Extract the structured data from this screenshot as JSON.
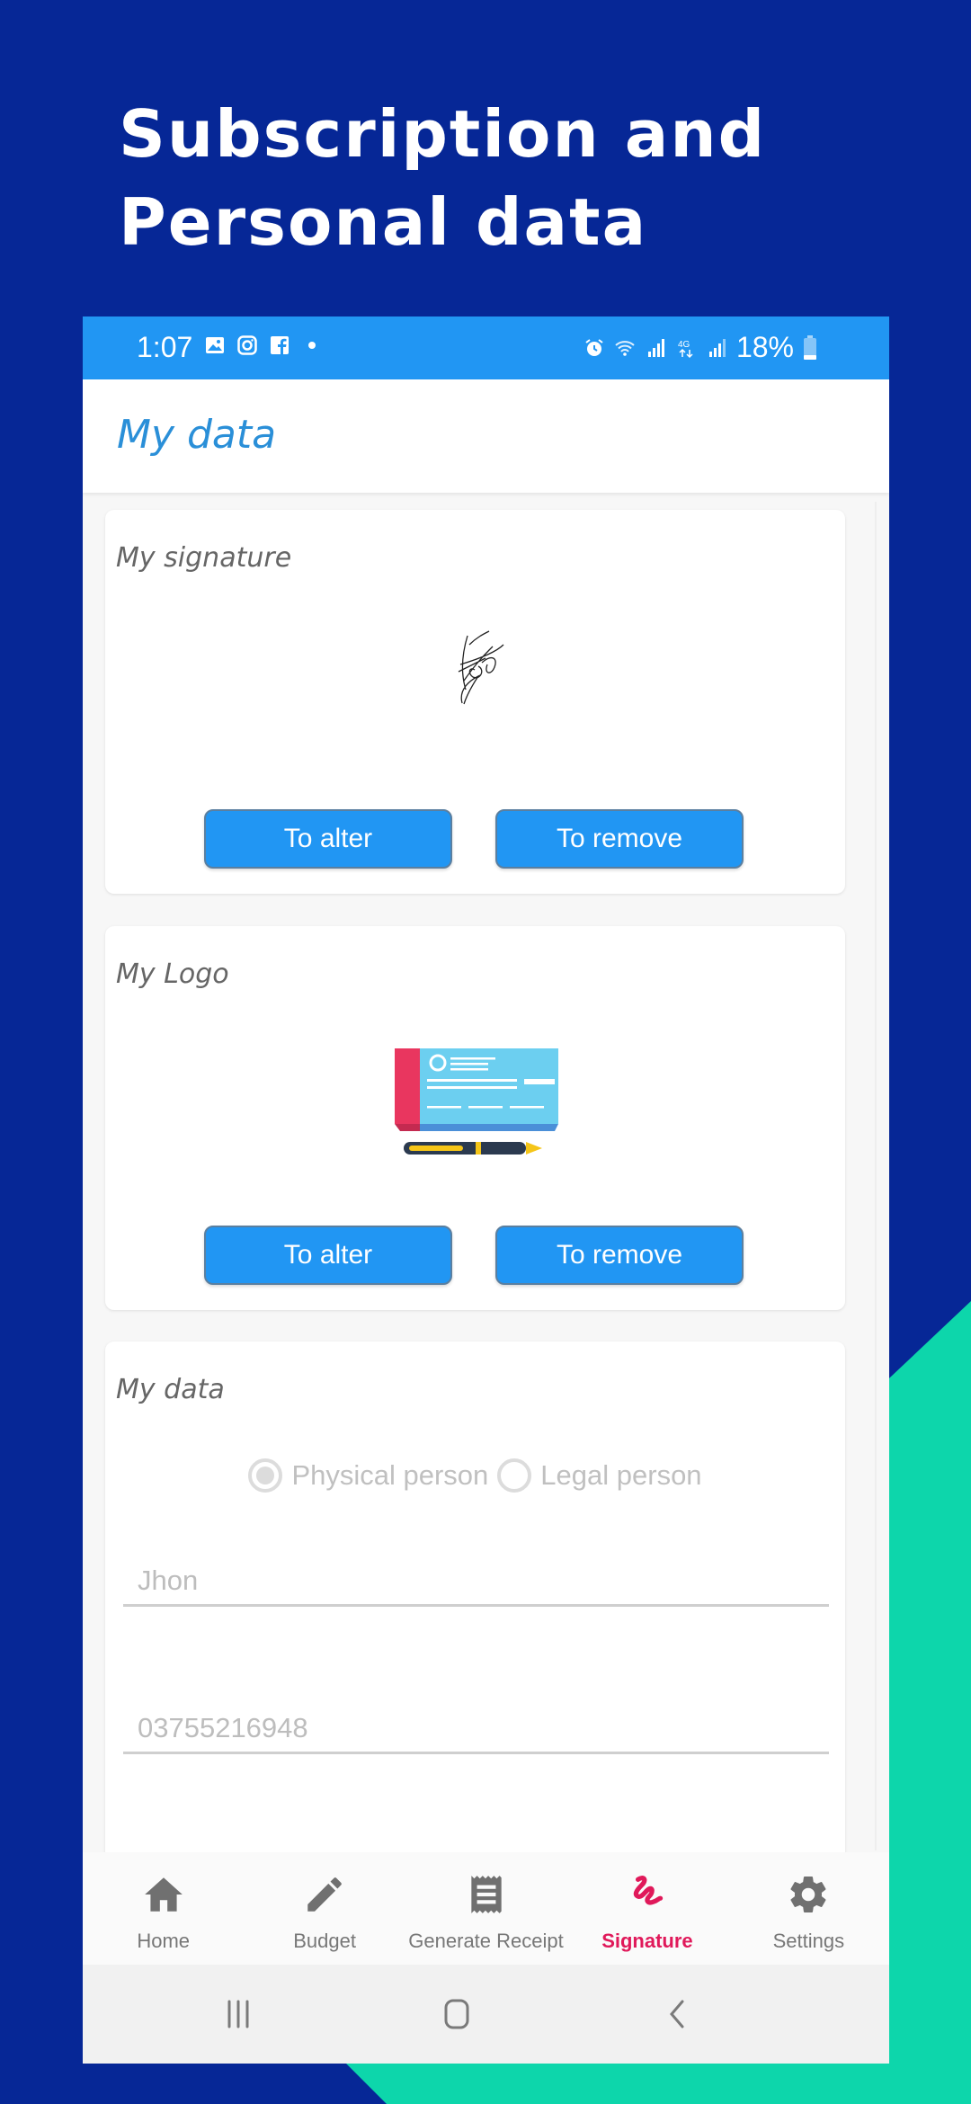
{
  "promo": {
    "headline_line1": "Subscription and",
    "headline_line2": "Personal data",
    "colors": {
      "background": "#062796",
      "accent": "#0dd6ab"
    }
  },
  "status_bar": {
    "time": "1:07",
    "left_icons": [
      "gallery-icon",
      "instagram-icon",
      "facebook-icon",
      "dot-icon"
    ],
    "right_icons": [
      "alarm-icon",
      "wifi-icon",
      "signal-icon",
      "4g-icon",
      "signal-icon"
    ],
    "battery": "18%"
  },
  "app_bar": {
    "title": "My data"
  },
  "signature_card": {
    "title": "My signature",
    "alter_label": "To alter",
    "remove_label": "To remove"
  },
  "logo_card": {
    "title": "My Logo",
    "alter_label": "To alter",
    "remove_label": "To remove"
  },
  "data_card": {
    "title": "My data",
    "person_type_options": [
      {
        "label": "Physical person",
        "selected": true
      },
      {
        "label": "Legal person",
        "selected": false
      }
    ],
    "name_value": "Jhon",
    "phone_value": "03755216948"
  },
  "bottom_nav": {
    "items": [
      {
        "label": "Home",
        "icon": "home-icon",
        "active": false
      },
      {
        "label": "Budget",
        "icon": "pencil-icon",
        "active": false
      },
      {
        "label": "Generate Receipt",
        "icon": "receipt-icon",
        "active": false
      },
      {
        "label": "Signature",
        "icon": "signature-icon",
        "active": true
      },
      {
        "label": "Settings",
        "icon": "gear-icon",
        "active": false
      }
    ],
    "active_color": "#e0195a"
  },
  "system_nav": {
    "buttons": [
      "recents-icon",
      "home-button-icon",
      "back-icon"
    ]
  }
}
